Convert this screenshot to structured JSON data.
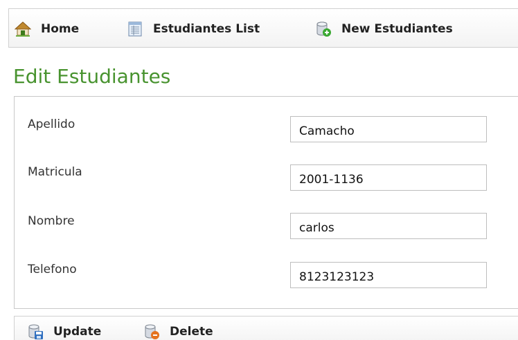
{
  "nav": {
    "home_label": "Home",
    "list_label": "Estudiantes List",
    "new_label": "New Estudiantes"
  },
  "page": {
    "title": "Edit Estudiantes"
  },
  "form": {
    "fields": [
      {
        "label": "Apellido",
        "value": "Camacho"
      },
      {
        "label": "Matricula",
        "value": "2001-1136"
      },
      {
        "label": "Nombre",
        "value": "carlos"
      },
      {
        "label": "Telefono",
        "value": "8123123123"
      }
    ]
  },
  "actions": {
    "update_label": "Update",
    "delete_label": "Delete"
  },
  "icons": {
    "home": "home-icon",
    "list": "list-icon",
    "new": "database-add-icon",
    "update": "database-save-icon",
    "delete": "database-delete-icon"
  },
  "colors": {
    "title": "#48932f",
    "home_roof": "#c0892f",
    "new_badge": "#3aa832",
    "update_badge": "#2f6fbf",
    "delete_badge": "#e5731f"
  }
}
